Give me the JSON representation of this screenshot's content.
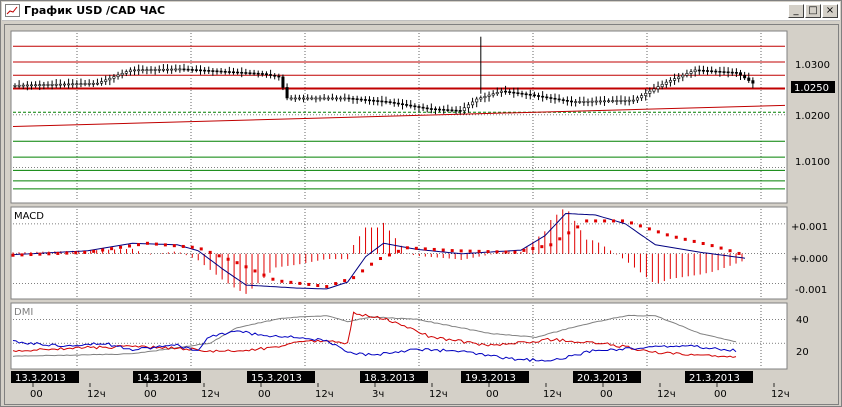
{
  "window": {
    "title": "График USD /CAD  ЧАС",
    "minimize_label": "_",
    "maximize_label": "□",
    "close_label": "×"
  },
  "colors": {
    "price_bar": "#000000",
    "resistance": "#c00000",
    "support": "#008000",
    "trend": "#c00000",
    "macd_line": "#000080",
    "signal_dots": "#e00000",
    "histogram": "#e00000",
    "dmi_plus": "#0000c0",
    "dmi_minus": "#d00000",
    "adx": "#808080",
    "last_price_bg": "#000000",
    "date_label_bg": "#000000"
  },
  "chart_data": [
    {
      "type": "candlestick",
      "title": "",
      "price_axis_labels": [
        "1.0300",
        "1.0250",
        "1.0200",
        "1.0100"
      ],
      "current_price": "1.0250",
      "ylim": [
        1.0037,
        1.0355
      ],
      "bars_count": 180,
      "key_points": [
        {
          "bar": 0,
          "close": 1.0256
        },
        {
          "bar": 20,
          "close": 1.026
        },
        {
          "bar": 28,
          "close": 1.0285
        },
        {
          "bar": 40,
          "close": 1.0287
        },
        {
          "bar": 60,
          "close": 1.0278
        },
        {
          "bar": 64,
          "close": 1.0272
        },
        {
          "bar": 66,
          "close": 1.0232
        },
        {
          "bar": 80,
          "close": 1.0232
        },
        {
          "bar": 90,
          "close": 1.0225
        },
        {
          "bar": 100,
          "close": 1.0212
        },
        {
          "bar": 108,
          "close": 1.0208
        },
        {
          "bar": 112,
          "close": 1.023
        },
        {
          "bar": 118,
          "close": 1.0245
        },
        {
          "bar": 125,
          "close": 1.0238
        },
        {
          "bar": 135,
          "close": 1.0225
        },
        {
          "bar": 150,
          "close": 1.0228
        },
        {
          "bar": 158,
          "close": 1.0262
        },
        {
          "bar": 165,
          "close": 1.0285
        },
        {
          "bar": 175,
          "close": 1.028
        },
        {
          "bar": 180,
          "close": 1.0255
        }
      ],
      "spike": {
        "bar": 113,
        "high": 1.0348
      },
      "resistance_levels": [
        1.033,
        1.03,
        1.0275,
        1.025
      ],
      "support_levels": [
        1.0205,
        1.015,
        1.012,
        1.0095,
        1.0075,
        1.006
      ],
      "trend_line": {
        "start": 1.0178,
        "end": 1.0218
      }
    },
    {
      "type": "line",
      "title": "MACD",
      "y_axis_labels": [
        "+0.001",
        "+0.000",
        "-0.001"
      ],
      "ylim": [
        -0.00145,
        0.0015
      ],
      "macd_points": [
        {
          "bar": 0,
          "v": -3e-05
        },
        {
          "bar": 25,
          "v": 0.0001
        },
        {
          "bar": 40,
          "v": 0.00035
        },
        {
          "bar": 55,
          "v": 0.0003
        },
        {
          "bar": 62,
          "v": 0.0001
        },
        {
          "bar": 70,
          "v": -0.0005
        },
        {
          "bar": 78,
          "v": -0.00105
        },
        {
          "bar": 95,
          "v": -0.00115
        },
        {
          "bar": 105,
          "v": -0.00118
        },
        {
          "bar": 112,
          "v": -0.00095
        },
        {
          "bar": 118,
          "v": -0.0001
        },
        {
          "bar": 124,
          "v": 0.00035
        },
        {
          "bar": 135,
          "v": 0.00015
        },
        {
          "bar": 150,
          "v": 0.0
        },
        {
          "bar": 170,
          "v": 0.00012
        },
        {
          "bar": 178,
          "v": 0.0006
        },
        {
          "bar": 185,
          "v": 0.00135
        },
        {
          "bar": 195,
          "v": 0.0013
        },
        {
          "bar": 205,
          "v": 0.001
        },
        {
          "bar": 215,
          "v": 0.0003
        },
        {
          "bar": 230,
          "v": 5e-05
        },
        {
          "bar": 245,
          "v": -0.00015
        }
      ],
      "signal_points": [
        {
          "bar": 0,
          "v": -5e-05
        },
        {
          "bar": 25,
          "v": 5e-05
        },
        {
          "bar": 45,
          "v": 0.00035
        },
        {
          "bar": 62,
          "v": 0.0002
        },
        {
          "bar": 75,
          "v": -0.0003
        },
        {
          "bar": 88,
          "v": -0.0009
        },
        {
          "bar": 105,
          "v": -0.0011
        },
        {
          "bar": 114,
          "v": -0.0008
        },
        {
          "bar": 122,
          "v": -0.0002
        },
        {
          "bar": 132,
          "v": 0.0002
        },
        {
          "bar": 148,
          "v": 0.0001
        },
        {
          "bar": 168,
          "v": 5e-05
        },
        {
          "bar": 180,
          "v": 0.0003
        },
        {
          "bar": 192,
          "v": 0.0011
        },
        {
          "bar": 205,
          "v": 0.0011
        },
        {
          "bar": 220,
          "v": 0.0006
        },
        {
          "bar": 235,
          "v": 0.00025
        },
        {
          "bar": 245,
          "v": -5e-05
        }
      ]
    },
    {
      "type": "line",
      "title": "DMI",
      "y_axis_labels": [
        "40",
        "20"
      ],
      "ylim": [
        0,
        52
      ],
      "dmi_plus_points": [
        {
          "bar": 0,
          "v": 21
        },
        {
          "bar": 15,
          "v": 18
        },
        {
          "bar": 30,
          "v": 20
        },
        {
          "bar": 40,
          "v": 15
        },
        {
          "bar": 55,
          "v": 18
        },
        {
          "bar": 62,
          "v": 14
        },
        {
          "bar": 66,
          "v": 26
        },
        {
          "bar": 75,
          "v": 30
        },
        {
          "bar": 85,
          "v": 26
        },
        {
          "bar": 95,
          "v": 25
        },
        {
          "bar": 105,
          "v": 22
        },
        {
          "bar": 112,
          "v": 12
        },
        {
          "bar": 120,
          "v": 10
        },
        {
          "bar": 135,
          "v": 15
        },
        {
          "bar": 150,
          "v": 13
        },
        {
          "bar": 165,
          "v": 7
        },
        {
          "bar": 180,
          "v": 5
        },
        {
          "bar": 195,
          "v": 14
        },
        {
          "bar": 210,
          "v": 16
        },
        {
          "bar": 225,
          "v": 18
        },
        {
          "bar": 240,
          "v": 14
        }
      ],
      "dmi_minus_points": [
        {
          "bar": 0,
          "v": 13
        },
        {
          "bar": 20,
          "v": 16
        },
        {
          "bar": 40,
          "v": 17
        },
        {
          "bar": 55,
          "v": 16
        },
        {
          "bar": 66,
          "v": 13
        },
        {
          "bar": 80,
          "v": 14
        },
        {
          "bar": 100,
          "v": 22
        },
        {
          "bar": 112,
          "v": 20
        },
        {
          "bar": 114,
          "v": 45
        },
        {
          "bar": 125,
          "v": 40
        },
        {
          "bar": 140,
          "v": 25
        },
        {
          "bar": 160,
          "v": 18
        },
        {
          "bar": 180,
          "v": 23
        },
        {
          "bar": 200,
          "v": 19
        },
        {
          "bar": 215,
          "v": 12
        },
        {
          "bar": 240,
          "v": 8
        }
      ],
      "adx_points": [
        {
          "bar": 0,
          "v": 9
        },
        {
          "bar": 40,
          "v": 11
        },
        {
          "bar": 66,
          "v": 20
        },
        {
          "bar": 75,
          "v": 33
        },
        {
          "bar": 90,
          "v": 41
        },
        {
          "bar": 105,
          "v": 43
        },
        {
          "bar": 112,
          "v": 38
        },
        {
          "bar": 120,
          "v": 42
        },
        {
          "bar": 135,
          "v": 40
        },
        {
          "bar": 160,
          "v": 28
        },
        {
          "bar": 175,
          "v": 25
        },
        {
          "bar": 190,
          "v": 35
        },
        {
          "bar": 205,
          "v": 43
        },
        {
          "bar": 215,
          "v": 43
        },
        {
          "bar": 230,
          "v": 28
        },
        {
          "bar": 242,
          "v": 21
        }
      ]
    },
    {
      "type": "time_axis",
      "dates": [
        "13.3.2013",
        "14.3.2013",
        "15.3.2013",
        "18.3.2013",
        "19.3.2013",
        "20.3.2013",
        "21.3.2013"
      ],
      "ticks": [
        {
          "bar": 0,
          "label": "00"
        },
        {
          "bar": 12,
          "label": "12ч"
        },
        {
          "bar": 24,
          "label": "00"
        },
        {
          "bar": 36,
          "label": "12ч"
        },
        {
          "bar": 48,
          "label": "00"
        },
        {
          "bar": 60,
          "label": "12ч"
        },
        {
          "bar": 72,
          "label": "3ч"
        },
        {
          "bar": 84,
          "label": "12ч"
        },
        {
          "bar": 96,
          "label": "00"
        },
        {
          "bar": 108,
          "label": "12ч"
        },
        {
          "bar": 120,
          "label": "00"
        },
        {
          "bar": 132,
          "label": "12ч"
        },
        {
          "bar": 144,
          "label": "00"
        },
        {
          "bar": 156,
          "label": "12ч"
        }
      ]
    }
  ]
}
